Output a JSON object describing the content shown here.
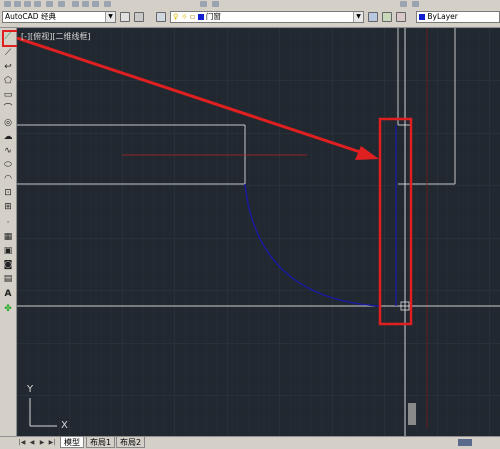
{
  "workspace": {
    "label": "AutoCAD 经典"
  },
  "layer": {
    "name": "门窗"
  },
  "color_control": {
    "label": "ByLayer"
  },
  "viewport": {
    "label": "[-][俯视][二维线框]"
  },
  "ucs": {
    "y_label": "Y",
    "x_label": "X"
  },
  "tabs": [
    {
      "label": "模型",
      "active": true
    },
    {
      "label": "布局1",
      "active": false
    },
    {
      "label": "布局2",
      "active": false
    }
  ],
  "left_tools": [
    "line-icon",
    "construction-line-icon",
    "polyline-icon",
    "polygon-icon",
    "rectangle-icon",
    "arc-icon",
    "circle-icon",
    "revision-cloud-icon",
    "spline-icon",
    "ellipse-icon",
    "ellipse-arc-icon",
    "insert-block-icon",
    "make-block-icon",
    "point-icon",
    "hatch-icon",
    "gradient-icon",
    "region-icon",
    "table-icon",
    "multiline-text-icon",
    "add-selected-icon"
  ],
  "colors": {
    "canvas_bg": "#212830",
    "annotation_red": "#e02020",
    "arc_blue": "#1a1aa0"
  }
}
